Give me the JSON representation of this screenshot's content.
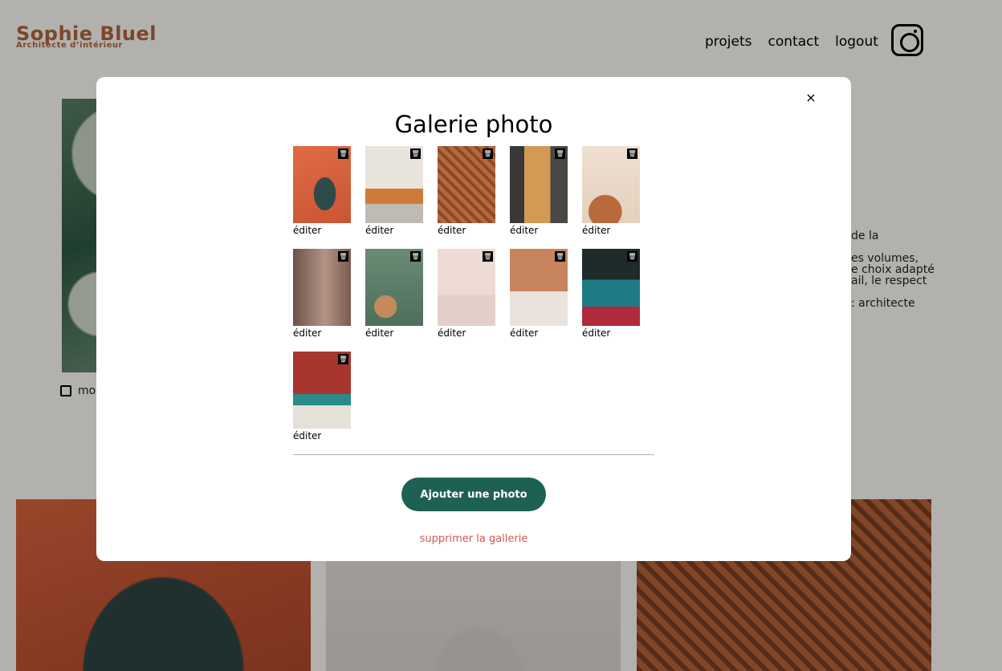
{
  "header": {
    "logo_title": "Sophie Bluel",
    "logo_subtitle": "Architecte d’intérieur",
    "nav": [
      "projets",
      "contact",
      "logout"
    ]
  },
  "intro": {
    "modify_label": "mod",
    "text_fragments": [
      "de la",
      "",
      "es volumes,",
      "e choix adapté",
      "ail, le respect",
      "",
      ": architecte"
    ]
  },
  "modal": {
    "title": "Galerie photo",
    "close_label": "×",
    "edit_label": "éditer",
    "trash_label": "🗑",
    "thumbnail_count": 11,
    "add_button_label": "Ajouter une photo",
    "delete_gallery_label": "supprimer la gallerie"
  },
  "colors": {
    "brand": "#b1663c",
    "primary_button": "#1d6154",
    "danger_link": "#d65353"
  }
}
